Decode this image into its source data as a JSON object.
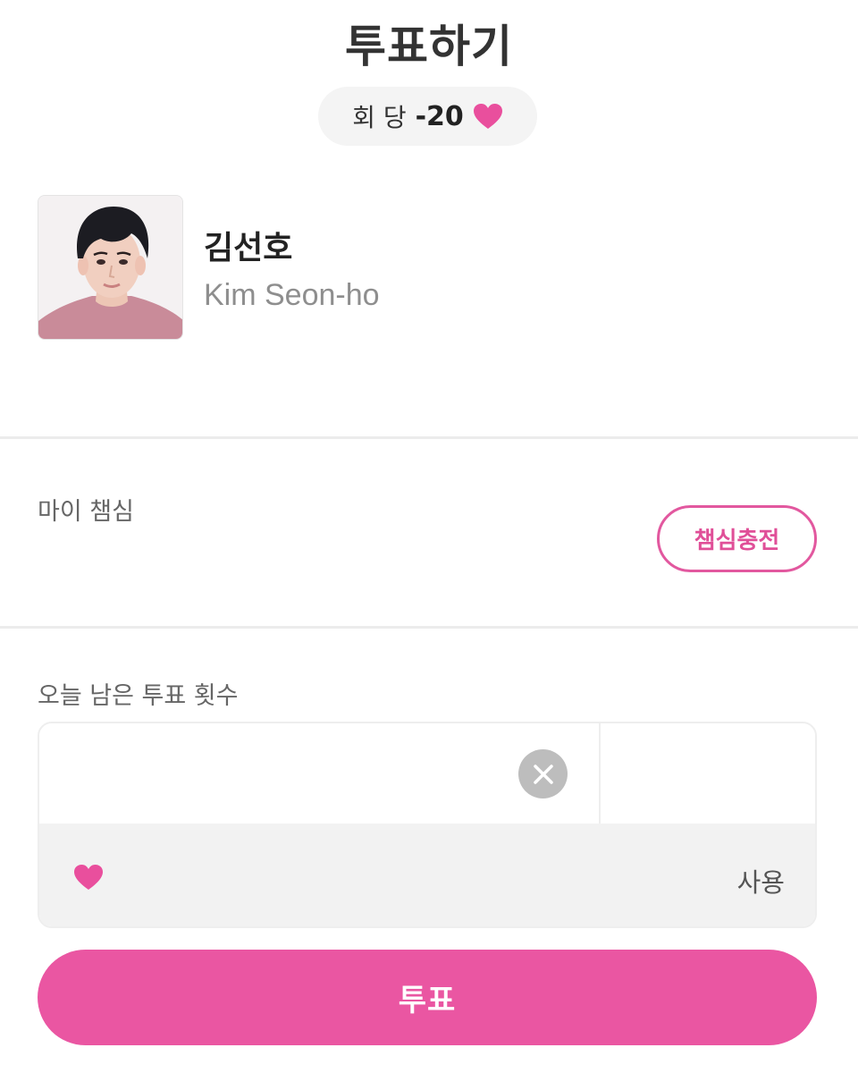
{
  "header": {
    "title": "투표하기"
  },
  "cost": {
    "label": "회 당",
    "value": "-20",
    "icon": "heart-icon",
    "heart_color": "#e94f9d"
  },
  "candidate": {
    "name_ko": "김선호",
    "name_en": "Kim Seon-ho",
    "photo": "candidate-photo"
  },
  "my_hearts": {
    "label": "마이 챔심",
    "charge_button": "챔심충전"
  },
  "votes_today": {
    "label": "오늘 남은 투표 횟수",
    "input_value": "",
    "clear_icon": "close-icon",
    "use_label": "사용"
  },
  "vote_button": {
    "label": "투표"
  },
  "colors": {
    "accent": "#ea56a2",
    "accent_text": "#e04f98",
    "divider": "#ececec",
    "input_panel": "#f2f2f2"
  }
}
